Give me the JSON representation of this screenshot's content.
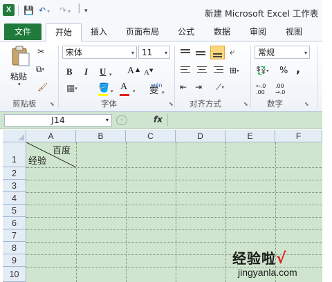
{
  "window": {
    "title": "新建 Microsoft Excel 工作表"
  },
  "app_icon": {
    "label": "X"
  },
  "quick_access": {
    "save": "💾",
    "undo": "↶",
    "redo": "↷",
    "customize": "▾"
  },
  "tabs": [
    {
      "label": "文件"
    },
    {
      "label": "开始"
    },
    {
      "label": "插入"
    },
    {
      "label": "页面布局"
    },
    {
      "label": "公式"
    },
    {
      "label": "数据"
    },
    {
      "label": "审阅"
    },
    {
      "label": "视图"
    }
  ],
  "ribbon": {
    "clipboard": {
      "paste": "粘贴",
      "group": "剪贴板"
    },
    "font": {
      "family": "宋体",
      "size": "11",
      "bold": "B",
      "italic": "I",
      "underline": "U",
      "grow": "A",
      "shrink": "A",
      "font_color": "A",
      "phonetic": "wén",
      "phonetic_char": "雯",
      "group": "字体"
    },
    "alignment": {
      "group": "对齐方式"
    },
    "number": {
      "format": "常规",
      "percent": "%",
      "comma": ",",
      "increase": "←.0 .00",
      "decrease": ".00 →.0",
      "group": "数字"
    }
  },
  "formula_bar": {
    "cell_ref": "J14",
    "fx": "fx",
    "value": ""
  },
  "sheet": {
    "columns": [
      "A",
      "B",
      "C",
      "D",
      "E",
      "F"
    ],
    "rows": [
      "1",
      "2",
      "3",
      "4",
      "5",
      "6",
      "7",
      "8",
      "9",
      "10"
    ],
    "a1_top": "百度",
    "a1_bottom": "经验"
  },
  "watermark": {
    "text": "经验啦",
    "check": "√",
    "url": "jingyanla.com"
  },
  "colors": {
    "excel_green": "#1f7a3b",
    "cell_fill": "#cfe5cd",
    "header_bg": "#e4ecf5",
    "selected_button": "#fbd77a"
  }
}
